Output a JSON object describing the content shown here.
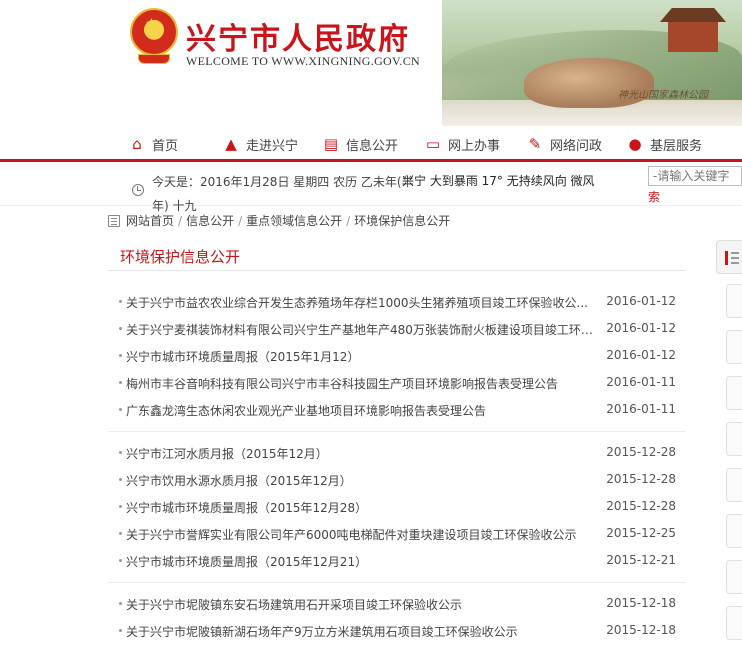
{
  "header": {
    "title": "兴宁市人民政府",
    "welcome": "WELCOME TO WWW.XINGNING.GOV.CN",
    "scenery_caption": "神光山国家森林公园",
    "emblem": "national-emblem-icon"
  },
  "nav": {
    "items": [
      {
        "label": "首页",
        "icon": "home-icon"
      },
      {
        "label": "走进兴宁",
        "icon": "landmark-icon"
      },
      {
        "label": "信息公开",
        "icon": "document-icon"
      },
      {
        "label": "网上办事",
        "icon": "monitor-icon"
      },
      {
        "label": "网络问政",
        "icon": "edit-icon"
      },
      {
        "label": "基层服务",
        "icon": "chat-icon"
      }
    ]
  },
  "info": {
    "date_line": "今天是：2016年1月28日 星期四 农历 乙未年(羊年) 十九",
    "weather": "兴宁 大到暴雨 17° 无持续风向 微风",
    "search_placeholder": "-请输入关键字",
    "search_suffix": "索"
  },
  "breadcrumb": {
    "items": [
      "网站首页",
      "信息公开",
      "重点领域信息公开",
      "环境保护信息公开"
    ],
    "separator": "/"
  },
  "panel": {
    "title": "环境保护信息公开"
  },
  "groups": [
    {
      "rows": [
        {
          "title": "关于兴宁市益农农业综合开发生态养殖场年存栏1000头生猪养殖项目竣工环保验收公...",
          "date": "2016-01-12"
        },
        {
          "title": "关于兴宁麦祺装饰材料有限公司兴宁生产基地年产480万张装饰耐火板建设项目竣工环保...",
          "date": "2016-01-12"
        },
        {
          "title": "兴宁市城市环境质量周报（2015年1月12）",
          "date": "2016-01-12"
        },
        {
          "title": "梅州市丰谷音响科技有限公司兴宁市丰谷科技园生产项目环境影响报告表受理公告",
          "date": "2016-01-11"
        },
        {
          "title": "广东鑫龙湾生态休闲农业观光产业基地项目环境影响报告表受理公告",
          "date": "2016-01-11"
        }
      ]
    },
    {
      "rows": [
        {
          "title": "兴宁市江河水质月报（2015年12月）",
          "date": "2015-12-28"
        },
        {
          "title": "兴宁市饮用水源水质月报（2015年12月）",
          "date": "2015-12-28"
        },
        {
          "title": "兴宁市城市环境质量周报（2015年12月28）",
          "date": "2015-12-28"
        },
        {
          "title": "关于兴宁市誉辉实业有限公司年产6000吨电梯配件对重块建设项目竣工环保验收公示",
          "date": "2015-12-25"
        },
        {
          "title": "兴宁市城市环境质量周报（2015年12月21）",
          "date": "2015-12-21"
        }
      ]
    },
    {
      "rows": [
        {
          "title": "关于兴宁市坭陂镇东安石场建筑用石开采项目竣工环保验收公示",
          "date": "2015-12-18"
        },
        {
          "title": "关于兴宁市坭陂镇新湖石场年产9万立方米建筑用石项目竣工环保验收公示",
          "date": "2015-12-18"
        }
      ]
    }
  ],
  "colors": {
    "brand_red": "#c8141a",
    "text": "#444444"
  }
}
